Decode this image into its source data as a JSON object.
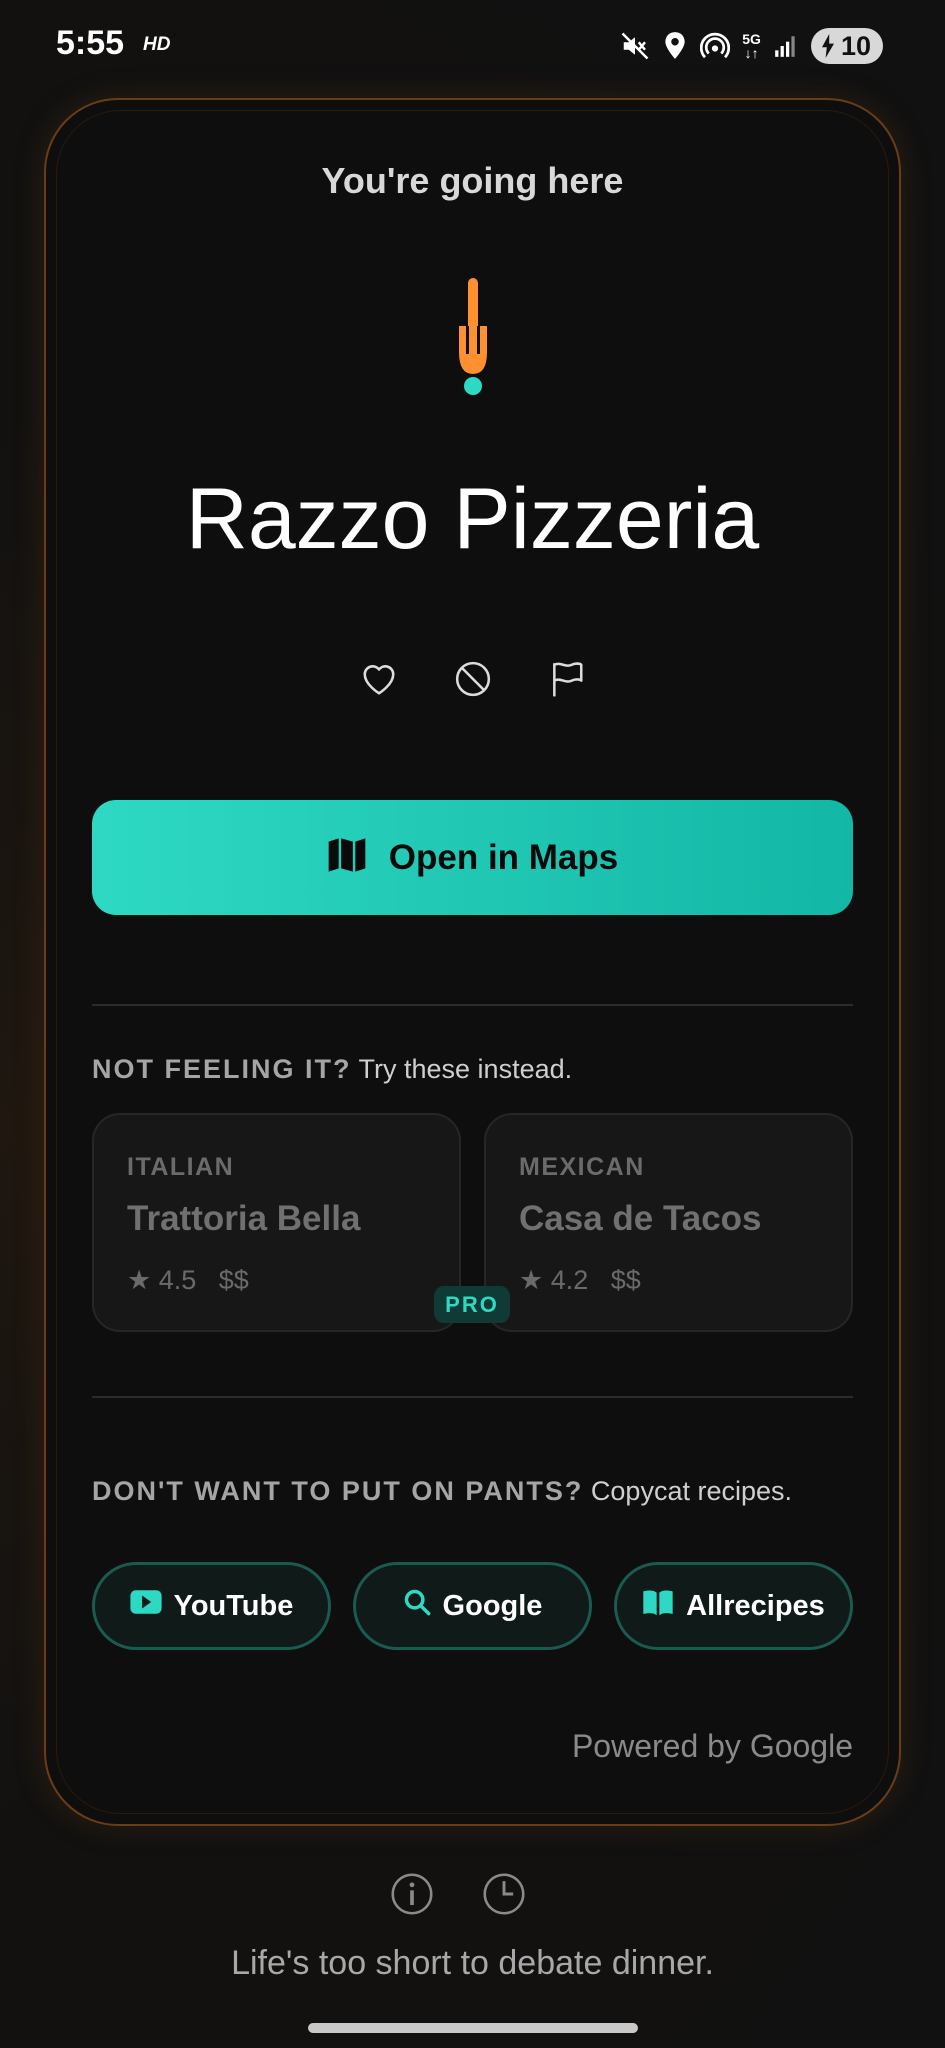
{
  "status_bar": {
    "time": "5:55",
    "hd": "HD",
    "network": "5G",
    "battery": "10"
  },
  "card": {
    "heading": "You're going here",
    "restaurant_name": "Razzo Pizzeria",
    "open_maps_label": "Open in Maps",
    "alternatives_title_caps": "NOT FEELING IT?",
    "alternatives_title_rest": "Try these instead.",
    "alternatives": [
      {
        "cuisine": "ITALIAN",
        "name": "Trattoria Bella",
        "rating": "★ 4.5",
        "price": "$$"
      },
      {
        "cuisine": "MEXICAN",
        "name": "Casa de Tacos",
        "rating": "★ 4.2",
        "price": "$$"
      }
    ],
    "pro_badge": "PRO",
    "recipes_title_caps": "DON'T WANT TO PUT ON PANTS?",
    "recipes_title_rest": "Copycat recipes.",
    "recipe_links": [
      {
        "label": "YouTube",
        "icon": "play-icon"
      },
      {
        "label": "Google",
        "icon": "search-icon"
      },
      {
        "label": "Allrecipes",
        "icon": "book-icon"
      }
    ],
    "powered_by": "Powered by Google"
  },
  "footer": {
    "tagline": "Life's too short to debate dinner."
  },
  "colors": {
    "accent": "#2ed9c3",
    "fork": "#ff9030",
    "card_border": "#6a3d17"
  }
}
